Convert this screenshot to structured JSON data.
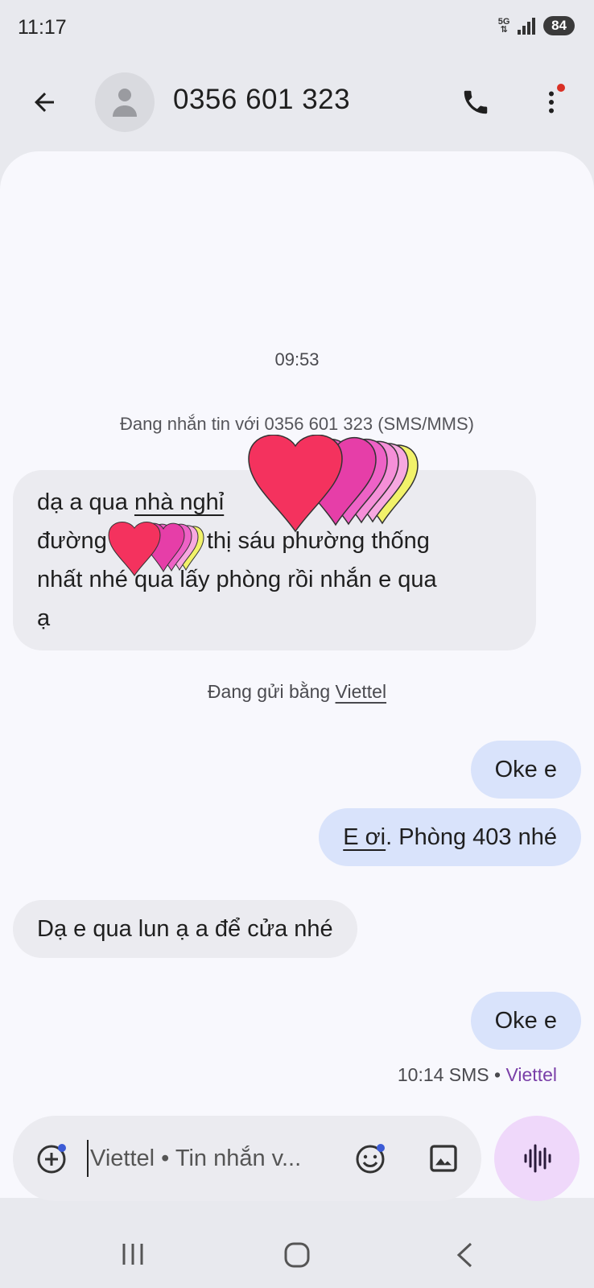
{
  "status_bar": {
    "time": "11:17",
    "network": "5G",
    "battery": "84"
  },
  "header": {
    "title": "0356 601 323",
    "icons": [
      "back-arrow-icon",
      "person-icon",
      "phone-icon",
      "more-vert-icon"
    ]
  },
  "conversation": {
    "date_label": "09:53",
    "sms_info": "Đang nhắn tin với 0356 601 323 (SMS/MMS)",
    "message1": {
      "line1_start": "dạ a qua ",
      "line1_link": "nhà nghỉ",
      "line2_start": "đường",
      "line2_rest": "thị sáu phường thống",
      "line3": "nhất nhé qua lấy phòng rồi nhắn e qua",
      "line4": "ạ"
    },
    "sending_prefix": "Đang gửi bằng ",
    "sending_carrier": "Viettel",
    "message2": "Oke e",
    "message3_link": "E ơi",
    "message3_rest": ". Phòng 403 nhé",
    "message4": "Dạ e qua lun ạ a để cửa nhé",
    "message5": "Oke e",
    "meta": {
      "time_type": "10:14 SMS • ",
      "carrier": "Viettel"
    }
  },
  "compose": {
    "placeholder": "Viettel • Tin nhắn v...",
    "icons": [
      "add-circle-icon",
      "emoji-icon",
      "image-icon",
      "voice-wave-icon"
    ]
  },
  "nav": {
    "icons": [
      "recent-apps-icon",
      "home-icon",
      "nav-back-icon"
    ]
  },
  "colors": {
    "incoming_bubble": "#ebebf0",
    "outgoing_bubble": "#d9e3fb",
    "voice_button": "#efd8fa",
    "carrier_accent": "#7a3fa8"
  }
}
